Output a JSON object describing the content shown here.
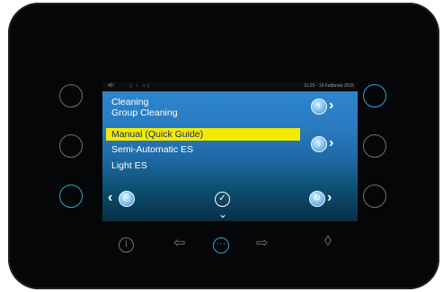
{
  "status_bar": {
    "temperature": "45°",
    "icons_text": "▯ ⍿ ≡▯",
    "datetime": "11:25 - 19 Febbraio 2015"
  },
  "screen": {
    "title_line1": "Cleaning",
    "title_line2": "Group Cleaning",
    "menu": [
      {
        "label": "Manual (Quick Guide)",
        "selected": true
      },
      {
        "label": "Semi-Automatic ES",
        "selected": false
      },
      {
        "label": "Light ES",
        "selected": false
      }
    ],
    "up_icon": "↑",
    "down_icon": "↓",
    "back_icon": "⎘",
    "refresh_icon": "↻",
    "confirm_icon": "✓",
    "chevron_right": "›",
    "chevron_left": "‹",
    "chevron_down": "⌄"
  },
  "bottom_bar": {
    "info": "i",
    "left_arrow": "⇦",
    "more": "···",
    "right_arrow": "⇨",
    "drop": "◊"
  },
  "colors": {
    "accent": "#2ea6d6",
    "selection": "#f2ea00",
    "selection_text": "#1b2a78"
  }
}
